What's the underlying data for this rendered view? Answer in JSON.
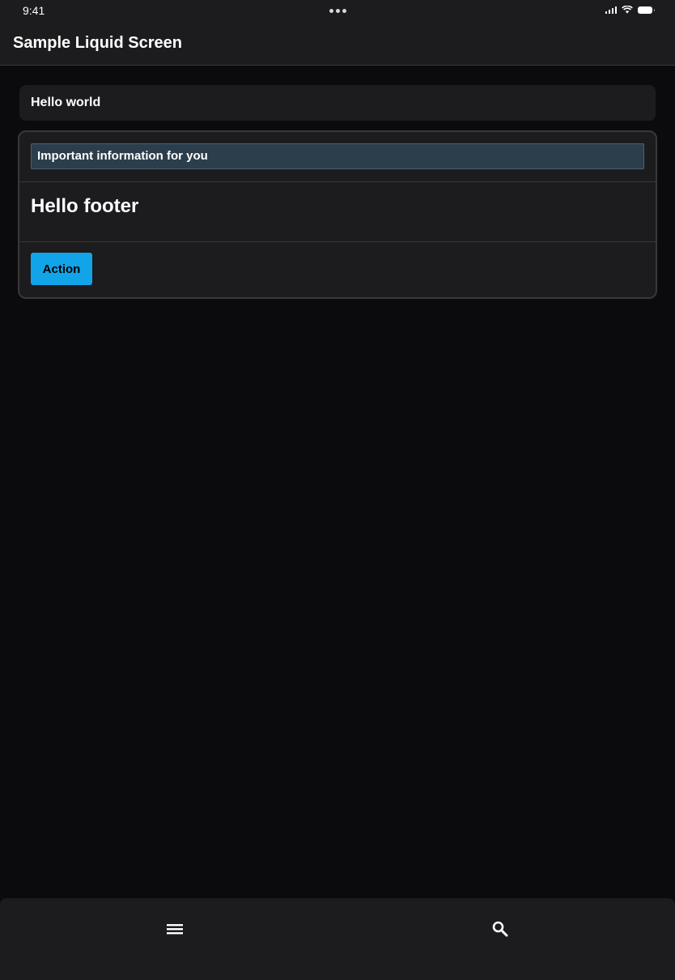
{
  "status_bar": {
    "time": "9:41",
    "icons": [
      "signal-icon",
      "wifi-icon",
      "battery-icon"
    ]
  },
  "header": {
    "title": "Sample Liquid Screen"
  },
  "main": {
    "hello_card": {
      "text": "Hello world"
    },
    "info_card": {
      "banner_text": "Important information for you",
      "footer_heading": "Hello footer",
      "action_label": "Action"
    }
  },
  "bottom_bar": {
    "icons": [
      "menu-icon",
      "search-icon"
    ]
  },
  "colors": {
    "background": "#0b0b0d",
    "surface": "#1c1c1e",
    "border": "#38383a",
    "banner_bg": "#2c3e4c",
    "accent": "#12a4e8"
  }
}
